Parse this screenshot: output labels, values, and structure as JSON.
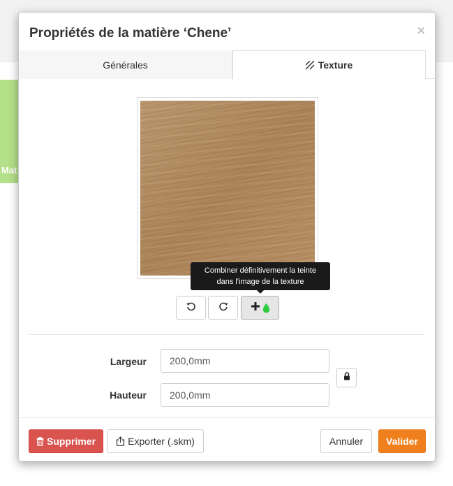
{
  "background": {
    "card_label": "Mat"
  },
  "modal": {
    "title": "Propriétés de la matière ‘Chene’",
    "close_label": "×",
    "tabs": [
      {
        "label": "Générales",
        "active": false
      },
      {
        "label": "Texture",
        "active": true,
        "icon": "hatch-icon"
      }
    ]
  },
  "texture": {
    "tooltip_line1": "Combiner définitivement la teinte",
    "tooltip_line2": "dans l'image de la texture",
    "tools": [
      {
        "name": "rotate-left",
        "icon": "rotate-ccw-icon"
      },
      {
        "name": "rotate-right",
        "icon": "rotate-cw-icon"
      },
      {
        "name": "combine-tint",
        "icon": "plus-drop-icon",
        "drop_color": "#2ecc40"
      }
    ]
  },
  "dimensions": {
    "width_label": "Largeur",
    "width_value": "200,0mm",
    "height_label": "Hauteur",
    "height_value": "200,0mm",
    "lock_icon": "lock-icon"
  },
  "footer": {
    "delete_label": "Supprimer",
    "export_label": "Exporter (.skm)",
    "cancel_label": "Annuler",
    "validate_label": "Valider"
  },
  "colors": {
    "danger": "#d9534f",
    "primary_orange": "#f0801e",
    "background_card": "#b5e08a"
  }
}
